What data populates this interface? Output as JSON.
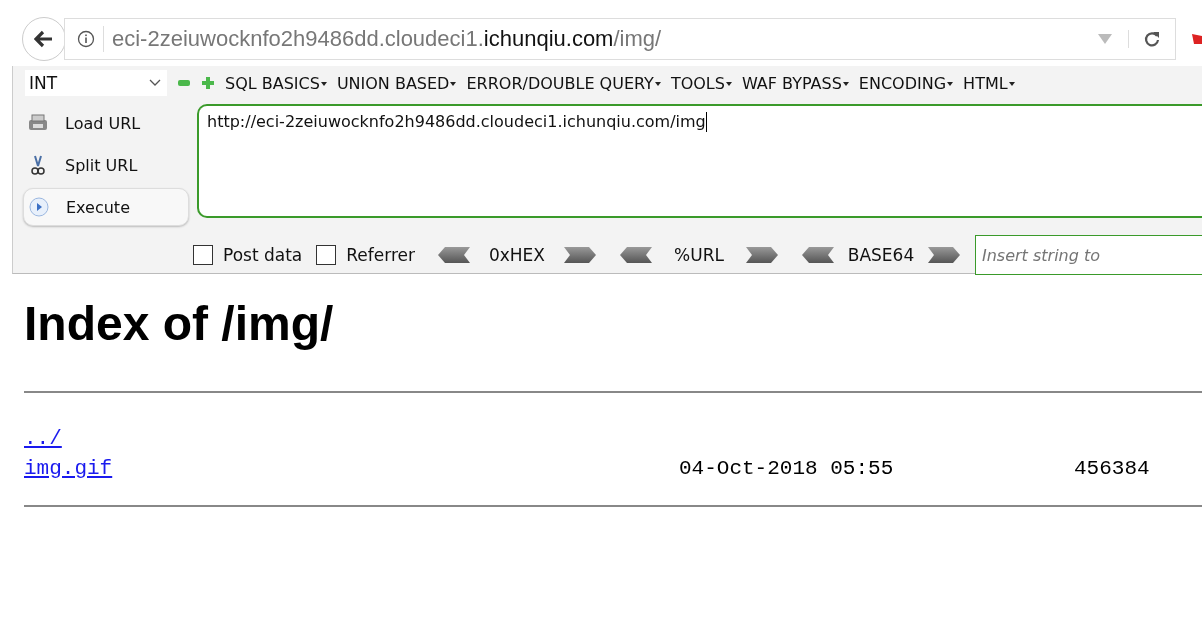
{
  "address_bar": {
    "url_parts": [
      {
        "text": "eci-2zeiuwocknfo2h9486dd.cloudeci1.",
        "emphasis": false
      },
      {
        "text": "ichunqiu.com",
        "emphasis": true
      },
      {
        "text": "/img/",
        "emphasis": false
      }
    ]
  },
  "hackbar": {
    "type_select": "INT",
    "menus": [
      "SQL BASICS",
      "UNION BASED",
      "ERROR/DOUBLE QUERY",
      "TOOLS",
      "WAF BYPASS",
      "ENCODING",
      "HTML"
    ],
    "actions": [
      {
        "kind": "load",
        "label": "Load URL"
      },
      {
        "kind": "split",
        "label": "Split URL"
      },
      {
        "kind": "execute",
        "label": "Execute"
      }
    ],
    "url_value": "http://eci-2zeiuwocknfo2h9486dd.cloudeci1.ichunqiu.com/img",
    "options": [
      {
        "label": "Post data",
        "checked": false
      },
      {
        "label": "Referrer",
        "checked": false
      }
    ],
    "encoders": [
      "0xHEX",
      "%URL",
      "BASE64"
    ],
    "insert_placeholder": "Insert string to"
  },
  "page": {
    "heading": "Index of /img/",
    "entries": [
      {
        "name": "../"
      },
      {
        "name": "img.gif",
        "date": "04-Oct-2018 05:55",
        "size": "456384"
      }
    ]
  }
}
